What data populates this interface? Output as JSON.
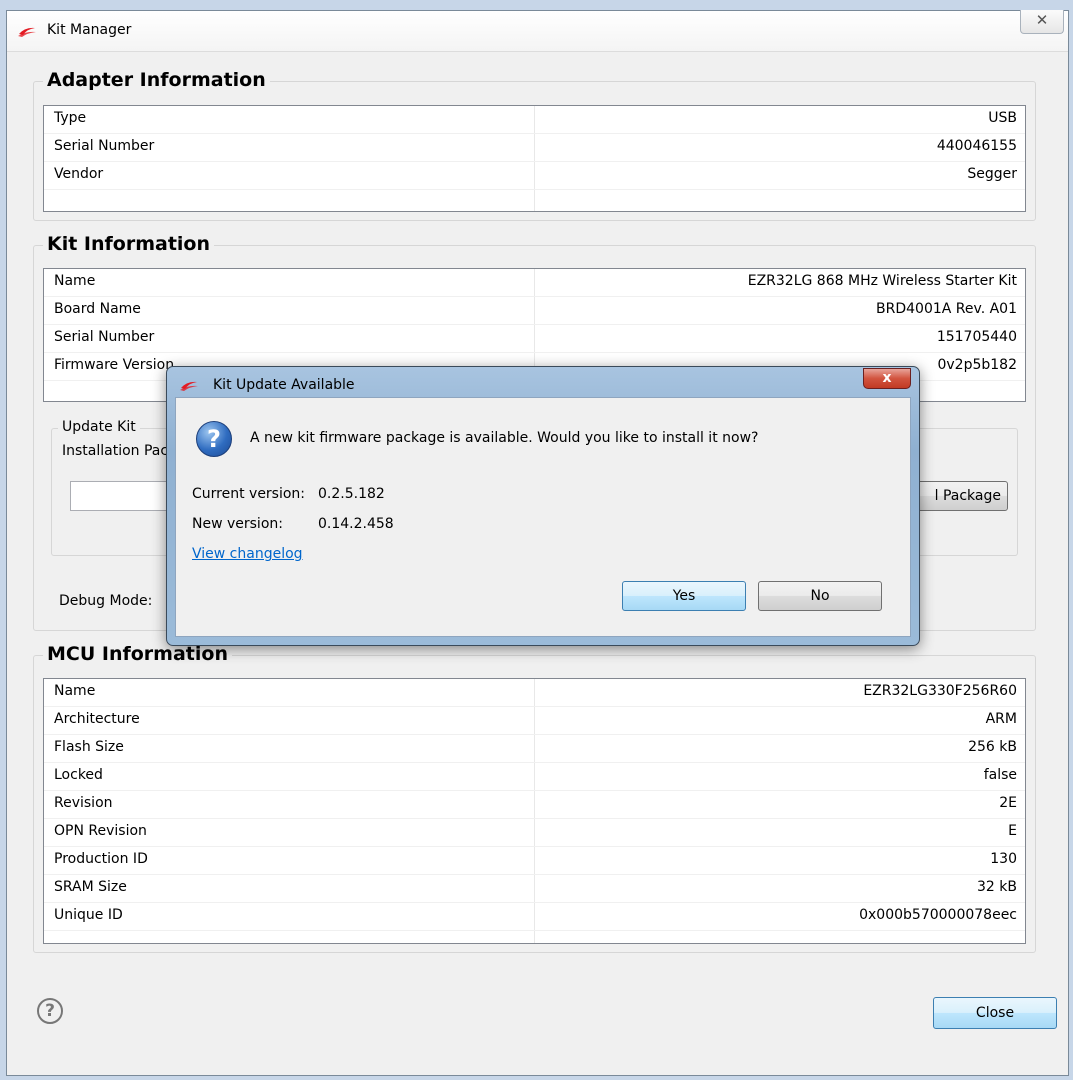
{
  "window": {
    "title": "Kit Manager",
    "close_glyph": "✕",
    "brand_color": "#e31b23"
  },
  "adapter": {
    "title": "Adapter Information",
    "rows": [
      {
        "k": "Type",
        "v": "USB"
      },
      {
        "k": "Serial Number",
        "v": "440046155"
      },
      {
        "k": "Vendor",
        "v": "Segger"
      }
    ]
  },
  "kit": {
    "title": "Kit Information",
    "rows": [
      {
        "k": "Name",
        "v": "EZR32LG 868 MHz Wireless Starter Kit"
      },
      {
        "k": "Board Name",
        "v": "BRD4001A Rev. A01"
      },
      {
        "k": "Serial Number",
        "v": "151705440"
      },
      {
        "k": "Firmware Version",
        "v": "0v2p5b182"
      }
    ],
    "update_group_label": "Update Kit",
    "install_label": "Installation Pac",
    "install_button": "l Package",
    "debug_label": "Debug Mode:"
  },
  "mcu": {
    "title": "MCU Information",
    "rows": [
      {
        "k": "Name",
        "v": "EZR32LG330F256R60"
      },
      {
        "k": "Architecture",
        "v": "ARM"
      },
      {
        "k": "Flash Size",
        "v": "256 kB"
      },
      {
        "k": "Locked",
        "v": "false"
      },
      {
        "k": "Revision",
        "v": "2E"
      },
      {
        "k": "OPN Revision",
        "v": "E"
      },
      {
        "k": "Production ID",
        "v": "130"
      },
      {
        "k": "SRAM Size",
        "v": "32 kB"
      },
      {
        "k": "Unique ID",
        "v": "0x000b570000078eec"
      }
    ]
  },
  "footer": {
    "help_glyph": "?",
    "close_button": "Close"
  },
  "dialog": {
    "title": "Kit Update Available",
    "close_glyph": "x",
    "icon_glyph": "?",
    "message": "A new kit firmware package is available.  Would you like to install it now?",
    "current_label": "Current version:",
    "current_value": "0.2.5.182",
    "new_label": "New version:",
    "new_value": "0.14.2.458",
    "changelog_link": "View changelog",
    "yes_button": "Yes",
    "no_button": "No"
  }
}
